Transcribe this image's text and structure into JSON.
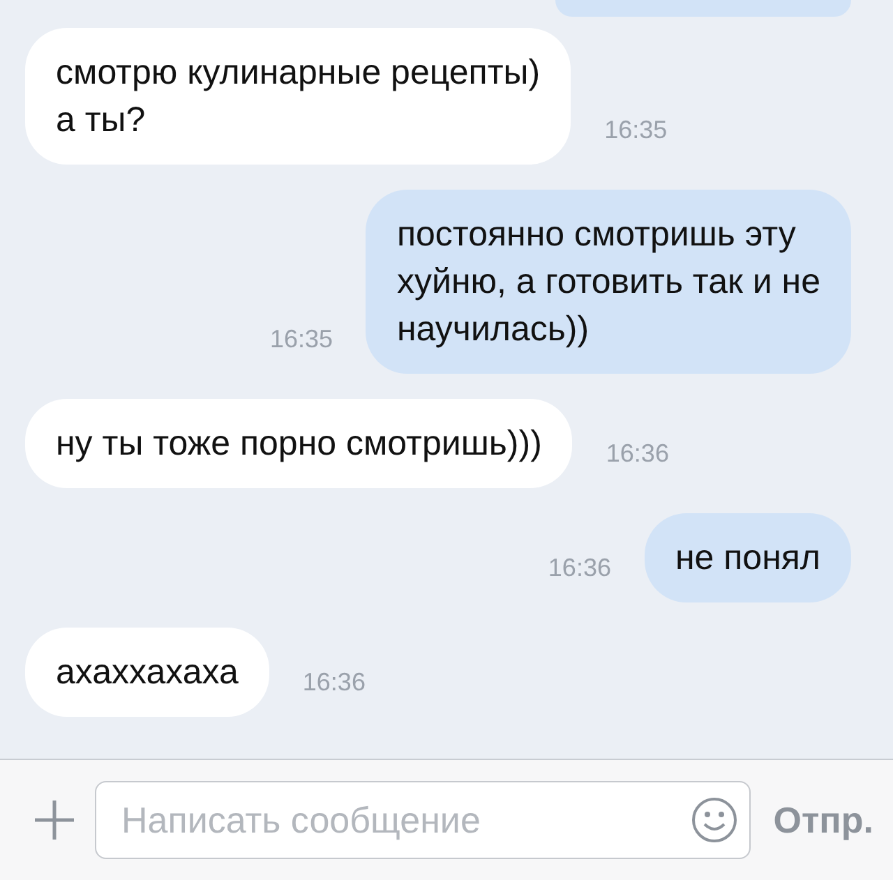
{
  "messages": [
    {
      "kind": "incoming",
      "text": "смотрю кулинарные рецепты)\nа ты?",
      "time": "16:35"
    },
    {
      "kind": "outgoing",
      "text": "постоянно смотришь эту\nхуйню, а готовить так и не\nнаучилась))",
      "time": "16:35"
    },
    {
      "kind": "incoming",
      "text": "ну ты тоже порно смотришь)))",
      "time": "16:36"
    },
    {
      "kind": "outgoing",
      "text": "не понял",
      "time": "16:36"
    },
    {
      "kind": "incoming",
      "text": "ахаххахаха",
      "time": "16:36"
    }
  ],
  "composer": {
    "placeholder": "Написать сообщение",
    "send_label": "Отпр."
  }
}
